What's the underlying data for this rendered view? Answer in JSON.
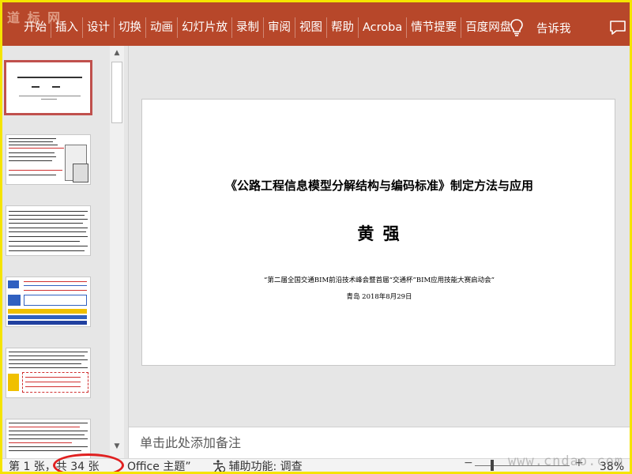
{
  "watermark_top": "道 标 网",
  "ribbon": {
    "tabs": [
      "开始",
      "插入",
      "设计",
      "切换",
      "动画",
      "幻灯片放",
      "录制",
      "审阅",
      "视图",
      "帮助",
      "Acroba",
      "情节提要",
      "百度网盘"
    ],
    "tell_me": "告诉我",
    "bulb_icon": "lightbulb-icon",
    "comment_icon": "comment-icon"
  },
  "slide": {
    "title": "《公路工程信息模型分解结构与编码标准》制定方法与应用",
    "author": "黄    强",
    "event": "“第二届全国交通BIM前沿技术峰会暨首届“交通杯”BIM应用技能大赛启动会”",
    "location_date": "青岛  2018年8月29日"
  },
  "notes": {
    "placeholder": "单击此处添加备注"
  },
  "status": {
    "slide_counter": "第 1 张，共 34 张",
    "theme": "Office 主题”",
    "accessibility": "辅助功能: 调查",
    "zoom": "38%"
  },
  "watermark_bottom": "www.cndao.com",
  "colors": {
    "ribbon": "#b7472a",
    "selection": "#c0504d",
    "highlight_ellipse": "#e02020",
    "frame": "#f5e400"
  }
}
